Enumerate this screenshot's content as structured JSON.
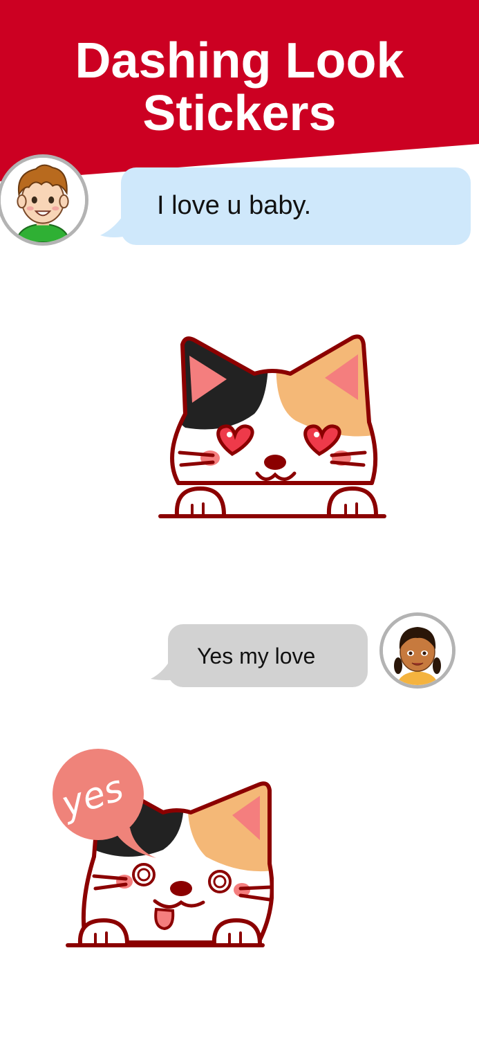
{
  "header": {
    "title_line1": "Dashing Look",
    "title_line2": "Stickers",
    "background_color": "#cc0022"
  },
  "messages": [
    {
      "sender": "boy",
      "text": "I love u baby.",
      "bubble_color": "#cfe8fb",
      "avatar_icon": "boy-avatar-icon"
    },
    {
      "sender": "girl",
      "text": "Yes my love",
      "bubble_color": "#d2d2d2",
      "avatar_icon": "girl-avatar-icon"
    }
  ],
  "stickers": [
    {
      "icon": "heart-eyes-calico-cat-icon"
    },
    {
      "icon": "dizzy-calico-cat-icon",
      "speech_text": "yes"
    }
  ]
}
